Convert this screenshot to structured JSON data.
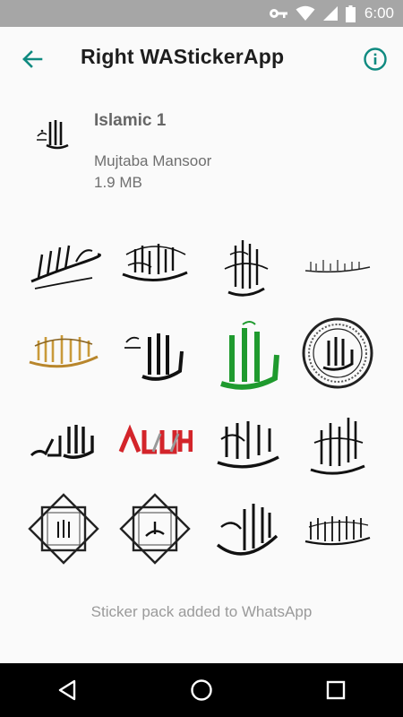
{
  "status_bar": {
    "time": "6:00",
    "icons": [
      "key-icon",
      "wifi-icon",
      "signal-icon",
      "battery-icon"
    ]
  },
  "app_bar": {
    "title": "Right WAStickerApp",
    "back_icon": "arrow-back-icon",
    "info_icon": "info-icon",
    "accent_color": "#0f8a80"
  },
  "pack": {
    "name": "Islamic 1",
    "author": "Mujtaba Mansoor",
    "size": "1.9 MB"
  },
  "stickers": [
    {
      "name": "sticker-bismillah-1",
      "style": "black"
    },
    {
      "name": "sticker-bismillah-2",
      "style": "black"
    },
    {
      "name": "sticker-bismillah-3",
      "style": "black"
    },
    {
      "name": "sticker-bismillah-4",
      "style": "black-thin"
    },
    {
      "name": "sticker-bismillah-gold",
      "style": "gold"
    },
    {
      "name": "sticker-allah-1",
      "style": "black"
    },
    {
      "name": "sticker-allah-green",
      "style": "green"
    },
    {
      "name": "sticker-allah-circle",
      "style": "circle"
    },
    {
      "name": "sticker-allahu-akbar",
      "style": "black"
    },
    {
      "name": "sticker-allah-red",
      "style": "red"
    },
    {
      "name": "sticker-alhamdulillah",
      "style": "black"
    },
    {
      "name": "sticker-tawakkaltu",
      "style": "black"
    },
    {
      "name": "sticker-allah-frame",
      "style": "frame"
    },
    {
      "name": "sticker-muhammad-frame",
      "style": "frame"
    },
    {
      "name": "sticker-inshallah",
      "style": "black"
    },
    {
      "name": "sticker-mashallah",
      "style": "black"
    }
  ],
  "status_message": "Sticker pack added to WhatsApp",
  "nav_bar": {
    "icons": [
      "back-triangle-icon",
      "home-circle-icon",
      "recents-square-icon"
    ]
  }
}
